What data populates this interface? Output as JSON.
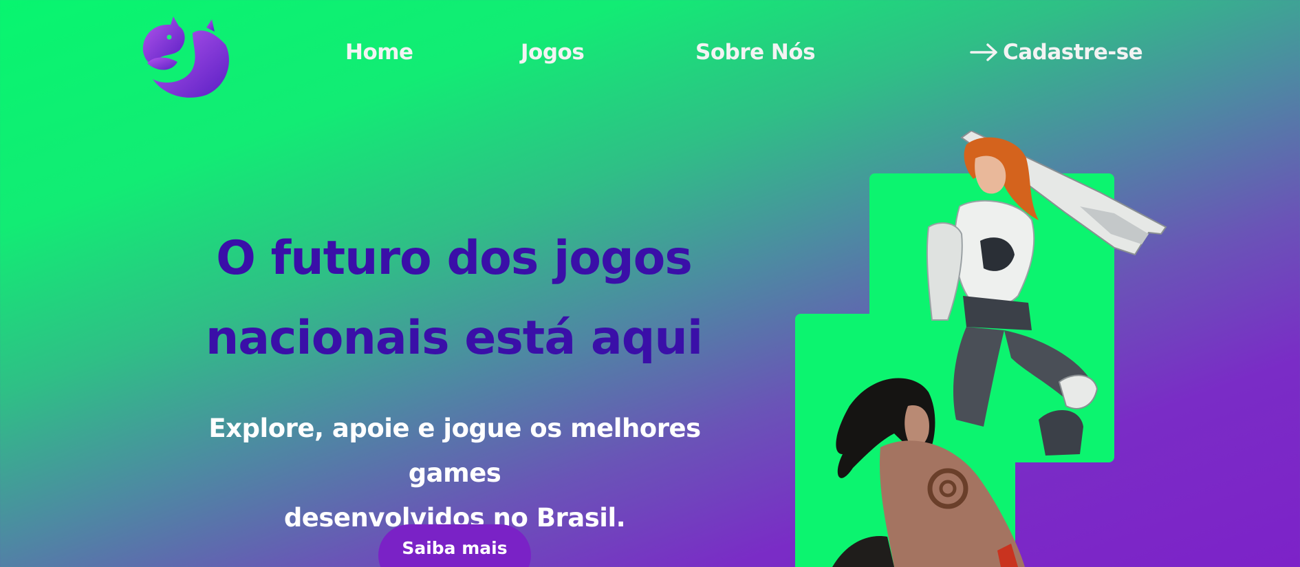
{
  "nav": {
    "home": "Home",
    "games": "Jogos",
    "about": "Sobre Nós",
    "signup": "Cadastre-se"
  },
  "hero": {
    "title_line1": "O futuro dos jogos",
    "title_line2": "nacionais está aqui",
    "subtitle_line1": "Explore, apoie e jogue os melhores games",
    "subtitle_line2": "desenvolvidos no Brasil.",
    "cta_label": "Saiba mais"
  },
  "colors": {
    "gradient_start": "#08f56f",
    "gradient_end": "#7d22c8",
    "title_color": "#3a0fa8",
    "accent_purple": "#7a22c6",
    "panel_green": "#0cf46f"
  },
  "icons": {
    "logo": "fox-logo-icon",
    "signup": "arrow-right-icon"
  }
}
